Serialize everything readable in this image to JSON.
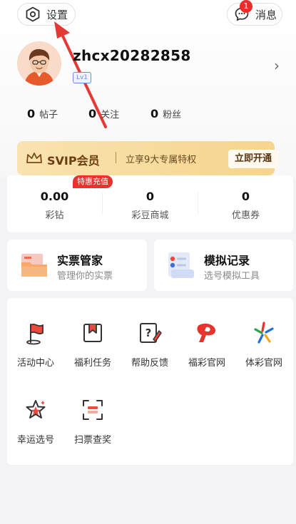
{
  "header": {
    "settings_label": "设置",
    "messages_label": "消息",
    "message_badge": "1"
  },
  "profile": {
    "username": "zhcx20282858",
    "level": "Lv1"
  },
  "stats": [
    {
      "value": "0",
      "label": "帖子"
    },
    {
      "value": "0",
      "label": "关注"
    },
    {
      "value": "0",
      "label": "粉丝"
    }
  ],
  "svip": {
    "title": "SVIP会员",
    "desc": "立享9大专属特权",
    "button": "立即开通"
  },
  "wallet": {
    "promo_tag": "特惠充值",
    "items": [
      {
        "value": "0.00",
        "label": "彩钻"
      },
      {
        "value": "0",
        "label": "彩豆商城"
      },
      {
        "value": "0",
        "label": "优惠券"
      }
    ]
  },
  "tools": [
    {
      "title": "实票管家",
      "subtitle": "管理你的实票"
    },
    {
      "title": "模拟记录",
      "subtitle": "选号模拟工具"
    }
  ],
  "grid": [
    {
      "label": "活动中心",
      "icon": "flag-icon"
    },
    {
      "label": "福利任务",
      "icon": "gift-task-icon"
    },
    {
      "label": "帮助反馈",
      "icon": "help-feedback-icon"
    },
    {
      "label": "福彩官网",
      "icon": "welfare-lottery-logo-icon"
    },
    {
      "label": "体彩官网",
      "icon": "sports-lottery-logo-icon"
    },
    {
      "label": "幸运选号",
      "icon": "lucky-star-icon"
    },
    {
      "label": "扫票查奖",
      "icon": "scan-ticket-icon"
    }
  ],
  "colors": {
    "accent_red": "#e8322d",
    "svip_gold": "#f6d58d",
    "background": "#f3f3f5"
  }
}
